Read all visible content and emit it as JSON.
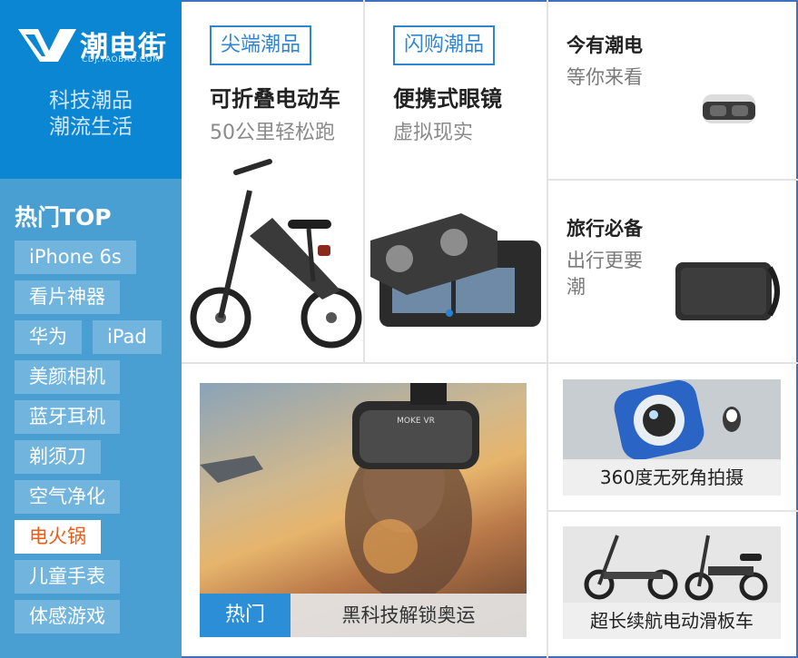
{
  "brand": {
    "logo_text": "潮电街",
    "logo_sub": "CDJ.TAOBAO.COM",
    "tagline_line1": "科技潮品",
    "tagline_line2": "潮流生活"
  },
  "sidebar": {
    "hot_title": "热门TOP",
    "tags": [
      "iPhone 6s",
      "看片神器",
      "华为",
      "iPad",
      "美颜相机",
      "蓝牙耳机",
      "剃须刀",
      "空气净化",
      "电火锅",
      "儿童手表",
      "体感游戏"
    ],
    "active_tag": "电火锅"
  },
  "cells": {
    "bike": {
      "badge": "尖端潮品",
      "title": "可折叠电动车",
      "sub": "50公里轻松跑"
    },
    "vr": {
      "badge": "闪购潮品",
      "title": "便携式眼镜",
      "sub": "虚拟现实"
    },
    "today": {
      "title": "今有潮电",
      "sub": "等你来看"
    },
    "travel": {
      "title": "旅行必备",
      "sub_line1": "出行更要",
      "sub_line2": "潮"
    }
  },
  "banner": {
    "hot_label": "热门",
    "caption": "黑科技解锁奥运",
    "headset_text": "MOKE VR"
  },
  "thumbs": {
    "camera": {
      "caption": "360度无死角拍摄"
    },
    "scooter": {
      "caption": "超长续航电动滑板车"
    }
  },
  "colors": {
    "brand_blue": "#0b86d2",
    "sidebar_blue": "#4a9fd2",
    "tag_blue": "#71b4de",
    "active_orange": "#ef5a15",
    "accent_blue": "#2f86cf"
  }
}
